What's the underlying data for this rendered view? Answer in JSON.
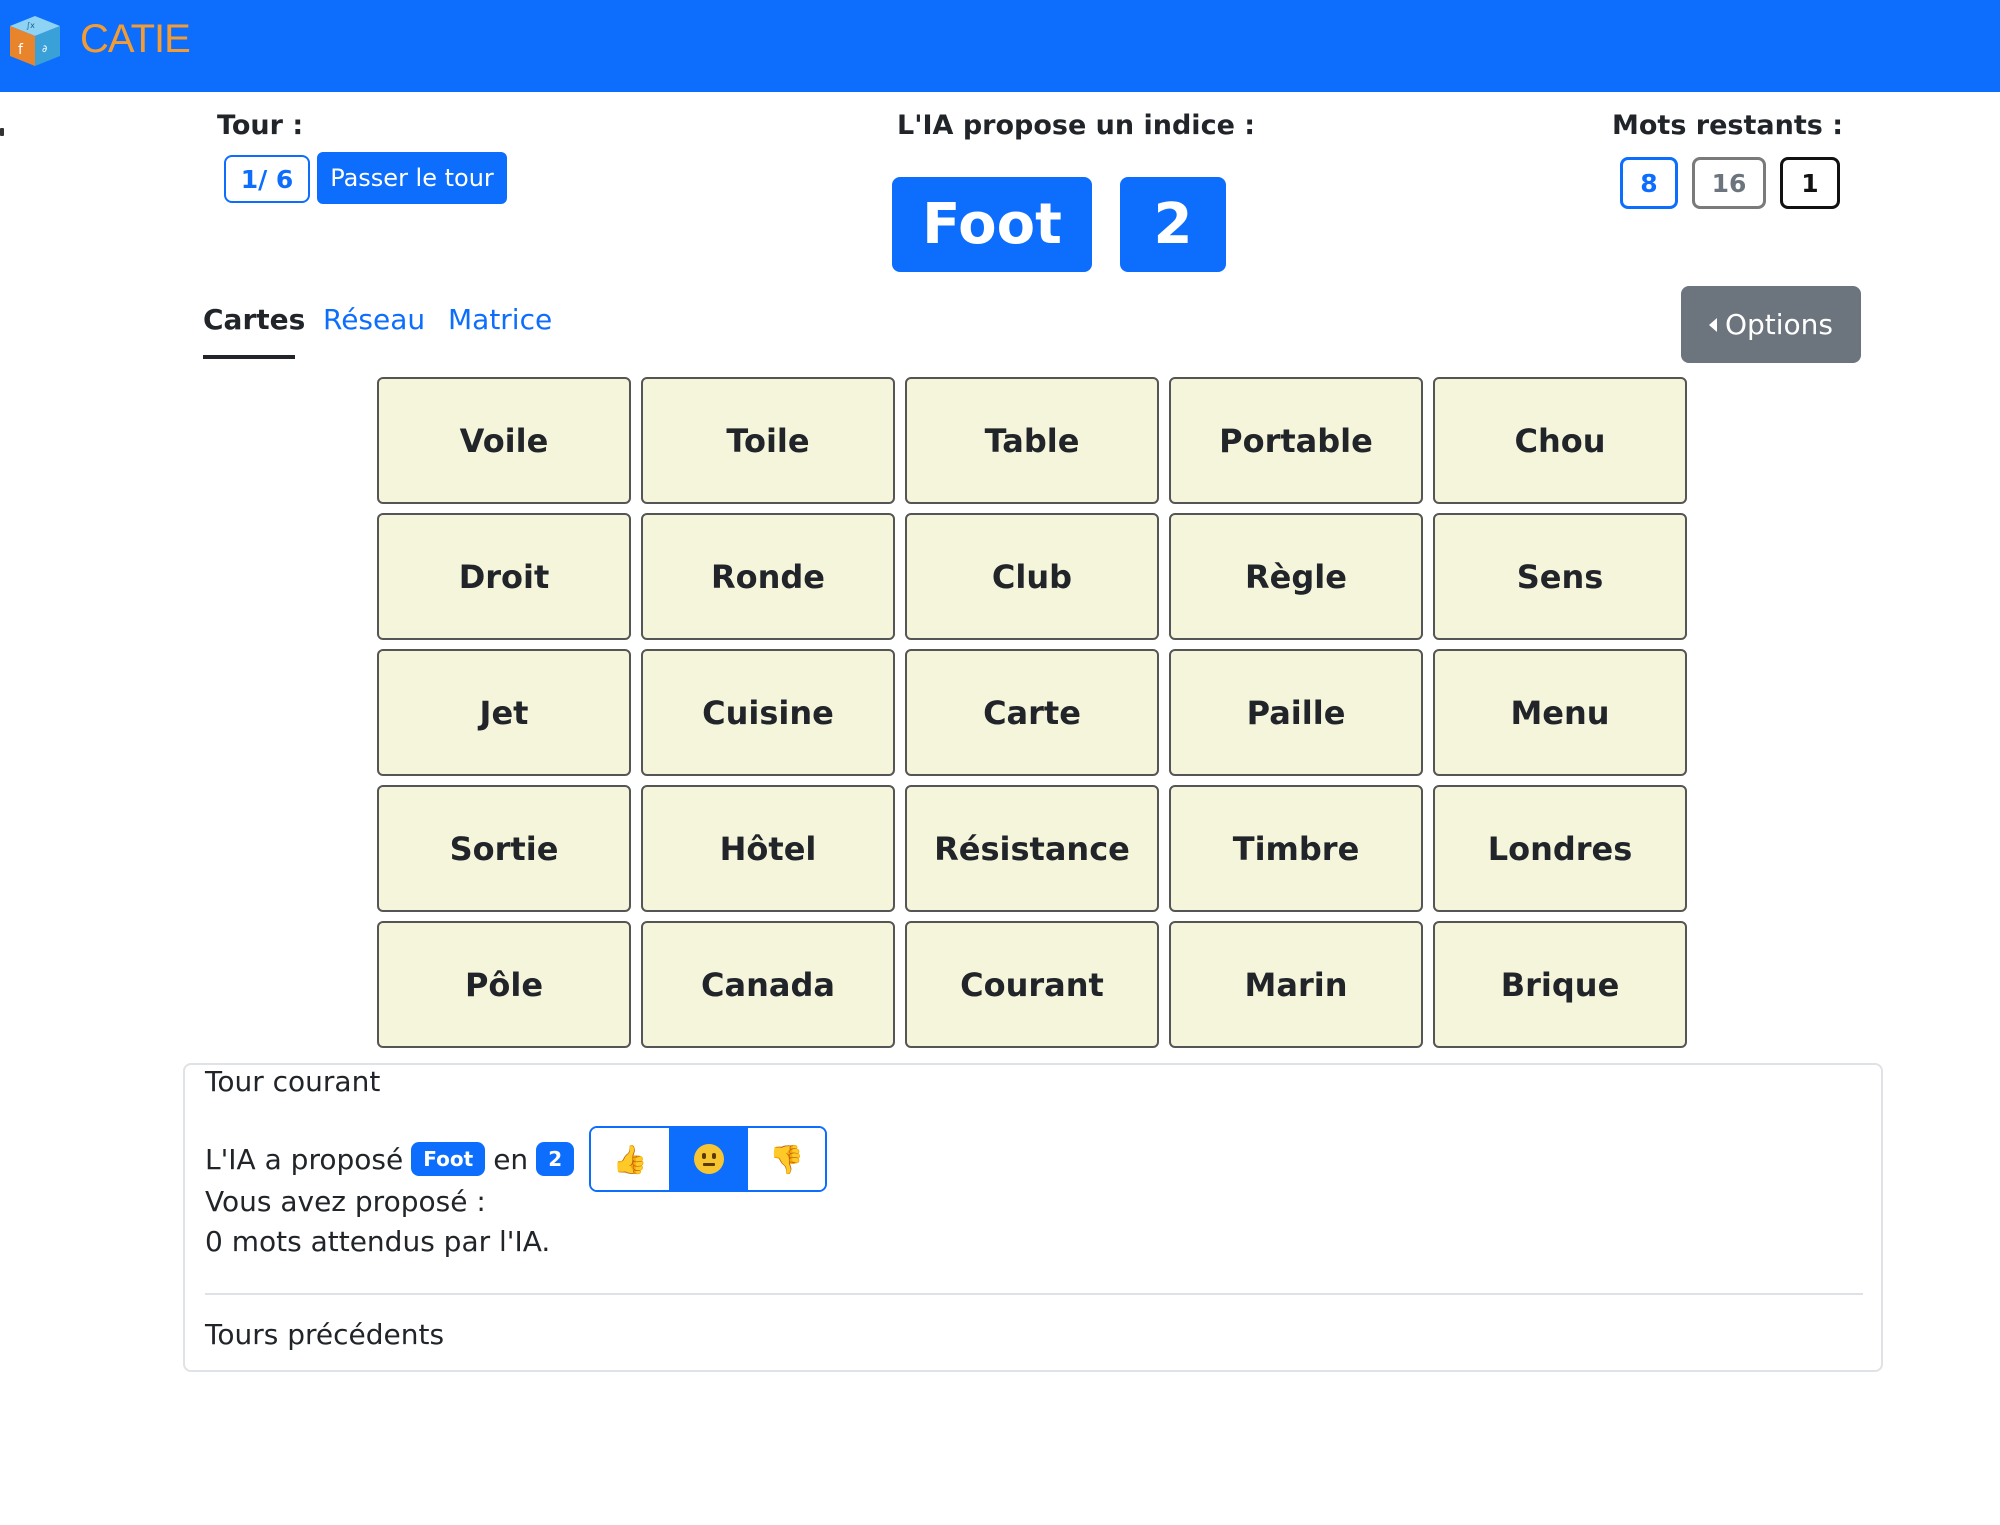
{
  "header": {
    "brand_name": "CATIE",
    "accent_color": "#0d6efd",
    "brand_color": "#f39c33"
  },
  "turn": {
    "label": "Tour :",
    "count": "1/ 6",
    "skip_label": "Passer le tour"
  },
  "clue": {
    "label": "L'IA propose un indice :",
    "word": "Foot",
    "number": "2"
  },
  "remaining": {
    "label": "Mots restants :",
    "blue": "8",
    "grey": "16",
    "black": "1"
  },
  "tabs": [
    {
      "label": "Cartes",
      "active": true
    },
    {
      "label": "Réseau",
      "active": false
    },
    {
      "label": "Matrice",
      "active": false
    }
  ],
  "options_label": "Options",
  "cards": [
    "Voile",
    "Toile",
    "Table",
    "Portable",
    "Chou",
    "Droit",
    "Ronde",
    "Club",
    "Règle",
    "Sens",
    "Jet",
    "Cuisine",
    "Carte",
    "Paille",
    "Menu",
    "Sortie",
    "Hôtel",
    "Résistance",
    "Timbre",
    "Londres",
    "Pôle",
    "Canada",
    "Courant",
    "Marin",
    "Brique"
  ],
  "panel": {
    "title": "Tour courant",
    "ia_prefix": "L'IA a proposé",
    "ia_word": "Foot",
    "ia_en": "en",
    "ia_number": "2",
    "votes": [
      {
        "icon": "thumbs-up-icon",
        "glyph": "👍",
        "active": false
      },
      {
        "icon": "neutral-face-icon",
        "glyph": "😐",
        "active": true
      },
      {
        "icon": "thumbs-down-icon",
        "glyph": "👎",
        "active": false
      }
    ],
    "vous_propose": "Vous avez proposé :",
    "mots_attendus": "0 mots attendus par l'IA.",
    "previous_title": "Tours précédents"
  }
}
